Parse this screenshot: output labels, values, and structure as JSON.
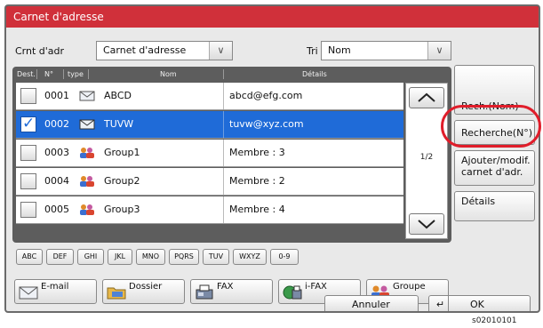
{
  "window": {
    "title": "Carnet d'adresse"
  },
  "top": {
    "book_label": "Crnt d'adr",
    "book_value": "Carnet d'adresse",
    "sort_label": "Tri",
    "sort_value": "Nom"
  },
  "table": {
    "headers": {
      "dest": "Dest.",
      "num": "N°",
      "type": "type",
      "name": "Nom",
      "details": "Détails"
    },
    "rows": [
      {
        "num": "0001",
        "type": "email-icon",
        "name": "ABCD",
        "details": "abcd@efg.com",
        "checked": false
      },
      {
        "num": "0002",
        "type": "email-icon",
        "name": "TUVW",
        "details": "tuvw@xyz.com",
        "checked": true
      },
      {
        "num": "0003",
        "type": "group-icon",
        "name": "Group1",
        "details": "Membre :   3",
        "checked": false
      },
      {
        "num": "0004",
        "type": "group-icon",
        "name": "Group2",
        "details": "Membre :   2",
        "checked": false
      },
      {
        "num": "0005",
        "type": "group-icon",
        "name": "Group3",
        "details": "Membre :   4",
        "checked": false
      }
    ],
    "page": "1/2"
  },
  "side": {
    "search_name": "Rech.(Nom)",
    "search_num": "Recherche(N°)",
    "edit": "Ajouter/modif.\ncarnet d'adr.",
    "details": "Détails"
  },
  "alpha_tabs": [
    "ABC",
    "DEF",
    "GHI",
    "JKL",
    "MNO",
    "PQRS",
    "TUV",
    "WXYZ",
    "0-9"
  ],
  "dest_buttons": [
    {
      "label": "E-mail",
      "icon": "email-icon"
    },
    {
      "label": "Dossier",
      "icon": "folder-icon"
    },
    {
      "label": "FAX",
      "icon": "fax-icon"
    },
    {
      "label": "i-FAX",
      "icon": "ifax-icon"
    },
    {
      "label": "Groupe",
      "icon": "group-icon"
    }
  ],
  "bottom": {
    "cancel": "Annuler",
    "ok": "OK"
  },
  "figure_code": "s02010101",
  "colors": {
    "title_bar": "#d0303a",
    "selection": "#1f6bd8",
    "callout": "#e01d2a"
  }
}
